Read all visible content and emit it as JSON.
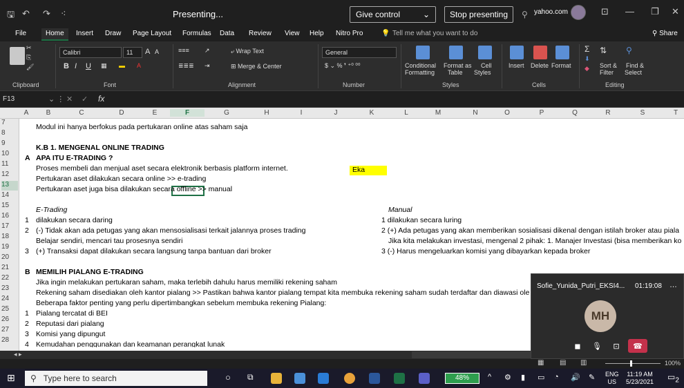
{
  "titlebar": {
    "presenting": "Presenting...",
    "give_control": "Give control",
    "stop_presenting": "Stop presenting",
    "account": "yahoo.com"
  },
  "menu": [
    "File",
    "Home",
    "Insert",
    "Draw",
    "Page Layout",
    "Formulas",
    "Data",
    "Review",
    "View",
    "Help",
    "Nitro Pro"
  ],
  "tell_me": "Tell me what you want to do",
  "share": "Share",
  "ribbon": {
    "font_name": "Calibri",
    "font_size": "11",
    "wrap_text": "Wrap Text",
    "merge_center": "Merge & Center",
    "number_format": "General",
    "conditional": "Conditional",
    "formatting": "Formatting",
    "format_as": "Format as",
    "table": "Table",
    "cell": "Cell",
    "styles_btn": "Styles",
    "insert": "Insert",
    "delete": "Delete",
    "format": "Format",
    "sort_filter": "Sort &",
    "filter": "Filter",
    "find": "Find &",
    "select": "Select",
    "groups": [
      "Clipboard",
      "Font",
      "Alignment",
      "Number",
      "Styles",
      "Cells",
      "Editing"
    ]
  },
  "namebox": "F13",
  "fx": "fx",
  "columns": [
    "A",
    "B",
    "C",
    "D",
    "E",
    "F",
    "G",
    "H",
    "I",
    "J",
    "K",
    "L",
    "M",
    "N",
    "O",
    "P",
    "Q",
    "R",
    "S",
    "T"
  ],
  "rows": [
    "7",
    "8",
    "9",
    "10",
    "11",
    "12",
    "13",
    "14",
    "15",
    "16",
    "17",
    "18",
    "19",
    "20",
    "21",
    "22",
    "23",
    "24",
    "25",
    "26",
    "27",
    "28"
  ],
  "cells": {
    "r7": "Modul ini hanya berfokus pada pertukaran online atas saham saja",
    "r9": "K.B 1. MENGENAL ONLINE TRADING",
    "r10a": "A",
    "r10": "APA ITU E-TRADING ?",
    "r11": "Proses membeli dan menjual aset secara elektronik berbasis platform internet.",
    "eka": "Eka",
    "r12": "Pertukaran aset dilakukan secara online >> e-trading",
    "r13": "Pertukaran aset juga bisa dilakukan secara offline >> manual",
    "r15": "E-Trading",
    "r15k": "Manual",
    "r16a": "1",
    "r16": "dilakukan secara daring",
    "r16k": "1 dilakukan secara luring",
    "r17a": "2",
    "r17": "(-) Tidak akan ada petugas yang akan mensosialisasi terkait jalannya proses trading",
    "r17k": "2 (+) Ada petugas yang akan memberikan sosialisasi dikenal dengan istilah broker atau piala",
    "r18": "Belajar sendiri, mencari tau prosesnya sendiri",
    "r18k": "Jika kita melakukan investasi, mengenal 2 pihak: 1. Manajer Investasi (bisa memberikan ko",
    "r19a": "3",
    "r19": "(+) Transaksi dapat dilakukan secara langsung tanpa bantuan dari broker",
    "r19k": "3 (-) Harus mengeluarkan komisi yang dibayarkan kepada broker",
    "r21a": "B",
    "r21": "MEMILIH PIALANG E-TRADING",
    "r22": "Jika ingin melakukan pertukaran saham, maka terlebih dahulu harus memiliki rekening saham",
    "r23": "Rekening saham disediakan oleh kantor pialang >> Pastikan bahwa kantor pialang tempat kita membuka rekening saham sudah terdaftar dan diawasi ole",
    "r24": "Beberapa faktor penting yang perlu dipertimbangkan sebelum membuka rekening Pialang:",
    "r25a": "1",
    "r25": "Pialang tercatat di BEI",
    "r26a": "2",
    "r26": "Reputasi dari pialang",
    "r27a": "3",
    "r27": "Komisi yang dipungut",
    "r28a": "4",
    "r28": "Kemudahan penggunakan dan keamanan perangkat lunak"
  },
  "call": {
    "name": "Sofie_Yunida_Putri_EKSI4...",
    "time": "01:19:08",
    "initials": "MH"
  },
  "status": {
    "zoom": "100%"
  },
  "taskbar": {
    "search": "Type here to search",
    "battery": "48%",
    "lang1": "ENG",
    "lang2": "US",
    "time": "11:19 AM",
    "date": "5/23/2021",
    "notif": "2"
  }
}
